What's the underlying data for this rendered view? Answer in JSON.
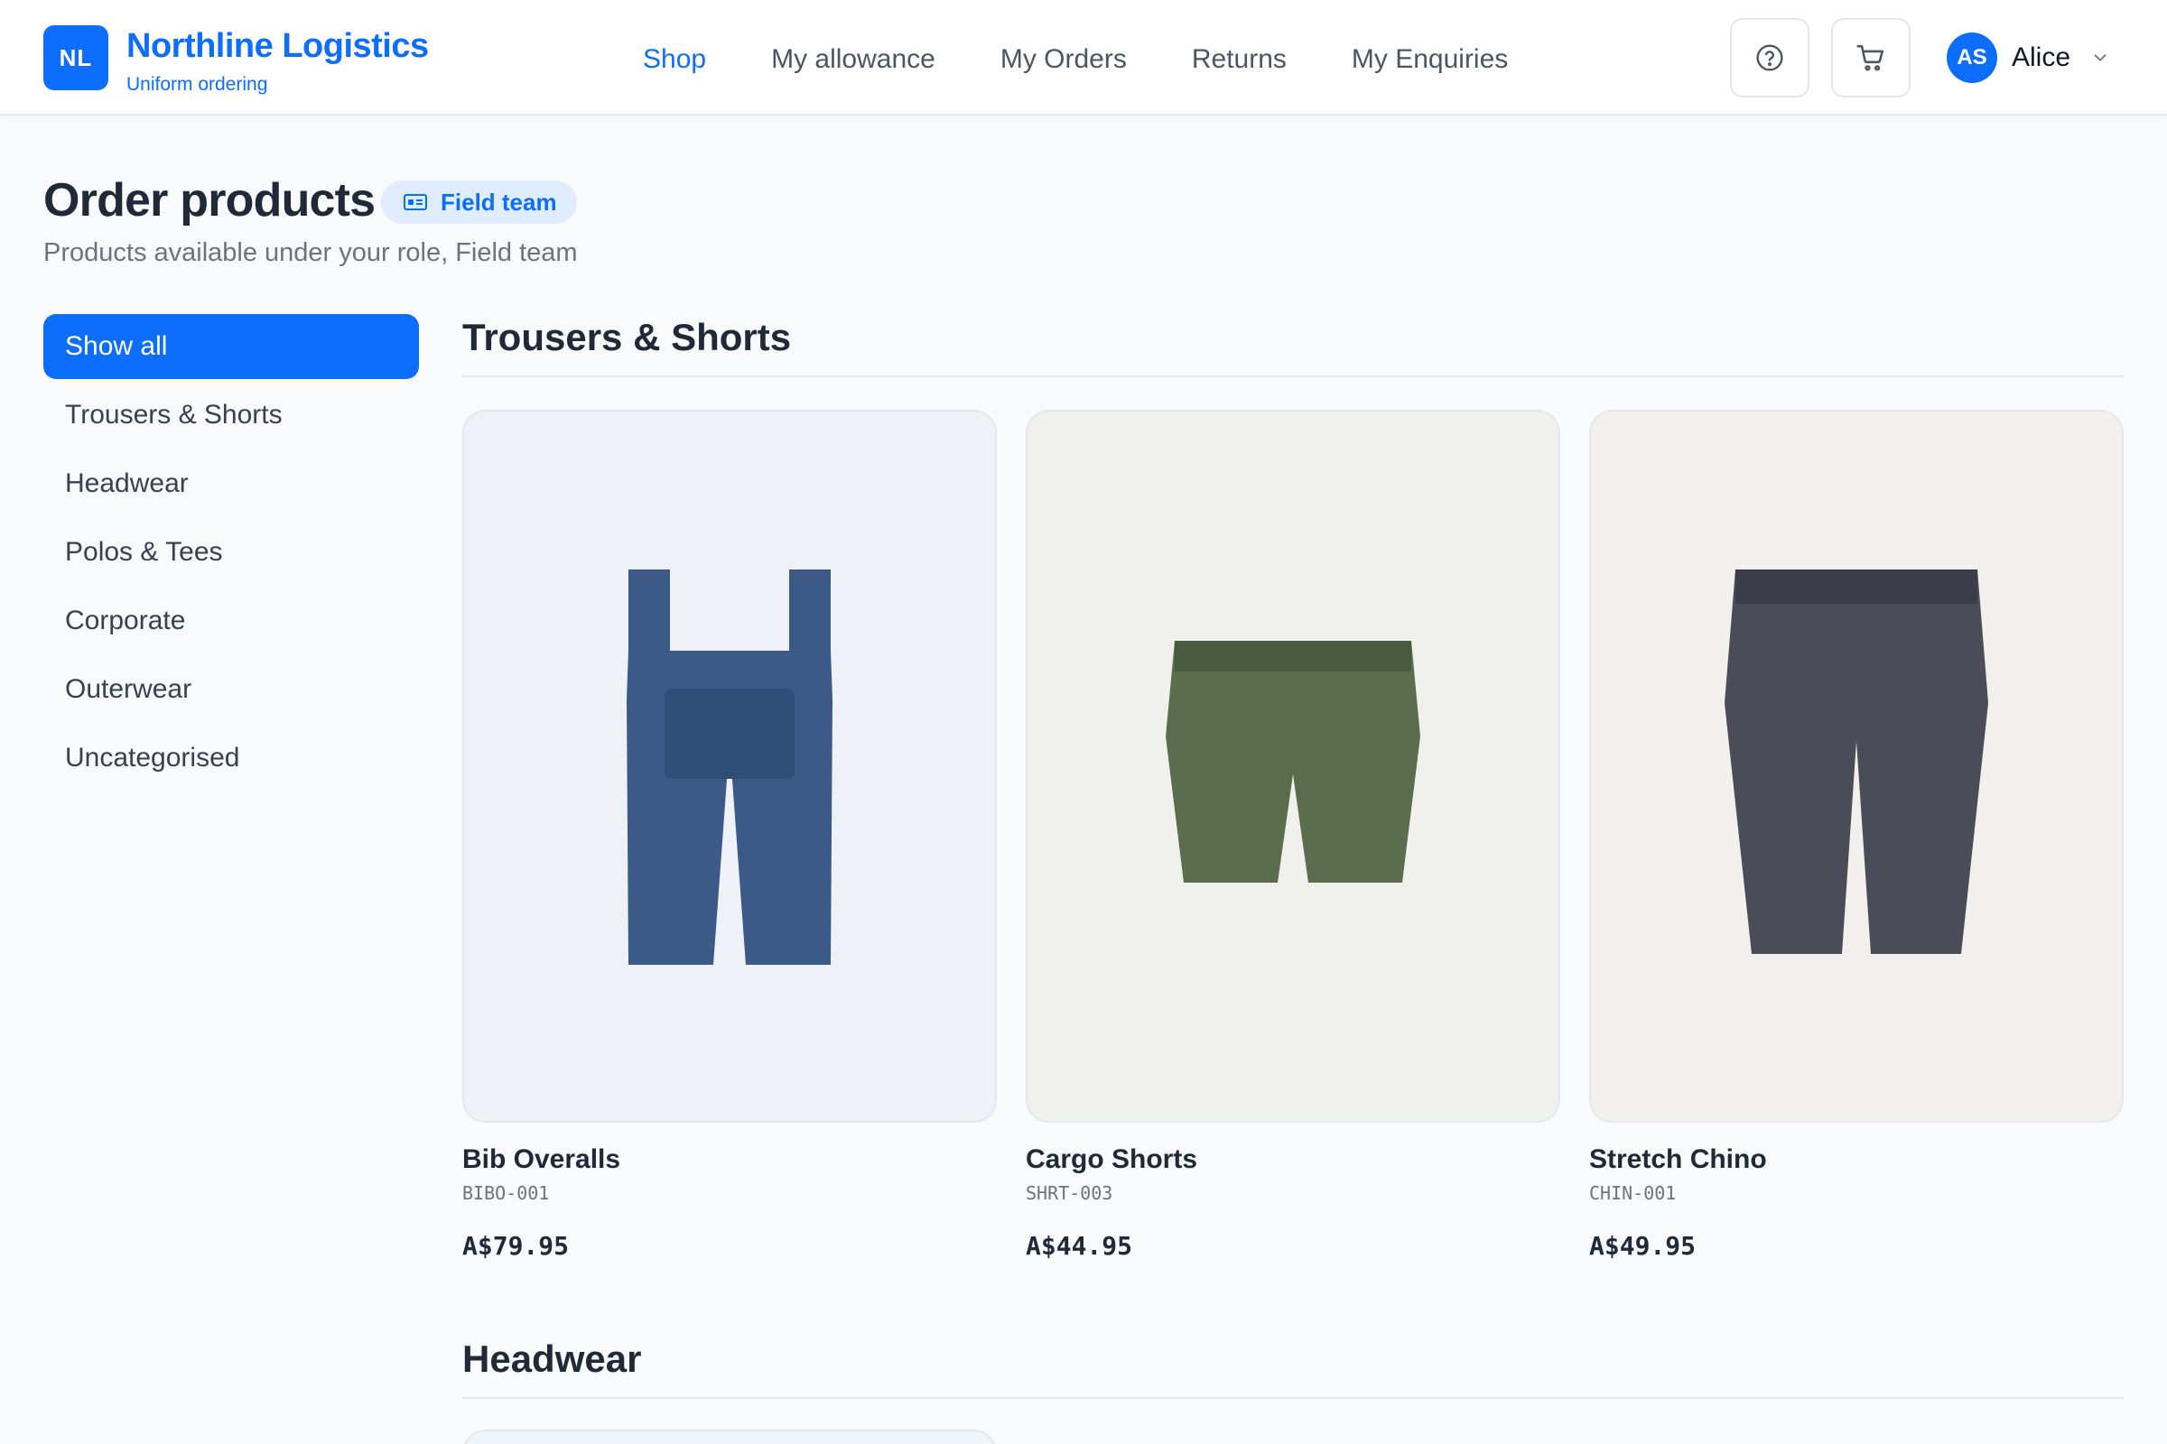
{
  "brand": {
    "logo": "NL",
    "name": "Northline Logistics",
    "subtitle": "Uniform ordering",
    "color": "#0d6efd"
  },
  "nav": [
    {
      "label": "Shop",
      "active": true
    },
    {
      "label": "My allowance"
    },
    {
      "label": "My Orders"
    },
    {
      "label": "Returns"
    },
    {
      "label": "My Enquiries"
    }
  ],
  "header_actions": {
    "help_icon": "help-circle-icon",
    "cart_icon": "cart-icon"
  },
  "user": {
    "initials": "AS",
    "name": "Alice"
  },
  "page": {
    "title": "Order products",
    "role_badge": "Field team",
    "subtitle": "Products available under your role, Field team"
  },
  "categories": [
    {
      "label": "Show all",
      "active": true
    },
    {
      "label": "Trousers & Shorts"
    },
    {
      "label": "Headwear"
    },
    {
      "label": "Polos & Tees"
    },
    {
      "label": "Corporate"
    },
    {
      "label": "Outerwear"
    },
    {
      "label": "Uncategorised"
    }
  ],
  "sections": [
    {
      "title": "Trousers & Shorts",
      "products": [
        {
          "name": "Bib Overalls",
          "sku": "BIBO-001",
          "price": "A$79.95",
          "image_icon": "bib-overalls-icon",
          "image_bg": "#eef1f8",
          "color": "#3b5a88"
        },
        {
          "name": "Cargo Shorts",
          "sku": "SHRT-003",
          "price": "A$44.95",
          "image_icon": "cargo-shorts-icon",
          "image_bg": "#f0f1ec",
          "color": "#5c6d4e"
        },
        {
          "name": "Stretch Chino",
          "sku": "CHIN-001",
          "price": "A$49.95",
          "image_icon": "chino-trousers-icon",
          "image_bg": "#f1f0ed",
          "color": "#4a4c57"
        }
      ]
    },
    {
      "title": "Headwear"
    }
  ]
}
